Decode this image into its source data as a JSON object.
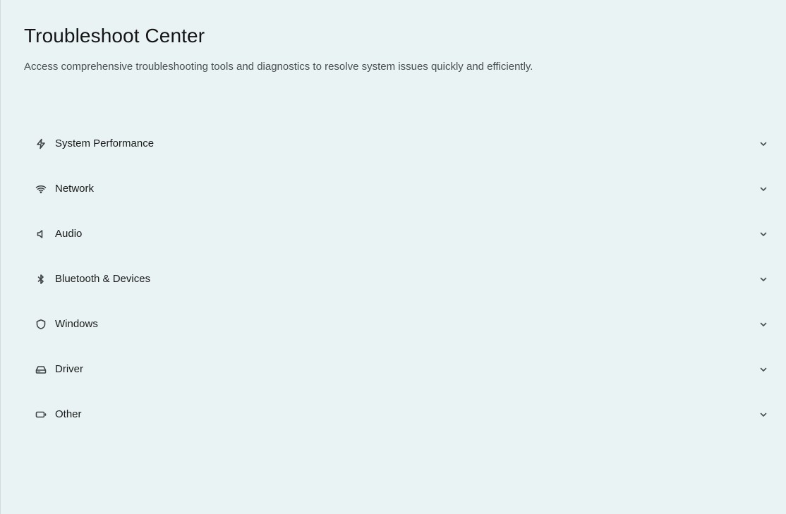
{
  "header": {
    "title": "Troubleshoot Center",
    "subtitle": "Access comprehensive troubleshooting tools and diagnostics to resolve system issues quickly and efficiently."
  },
  "categories": [
    {
      "label": "System Performance",
      "icon": "lightning-icon"
    },
    {
      "label": "Network",
      "icon": "wifi-icon"
    },
    {
      "label": "Audio",
      "icon": "speaker-icon"
    },
    {
      "label": "Bluetooth & Devices",
      "icon": "bluetooth-icon"
    },
    {
      "label": "Windows",
      "icon": "shield-icon"
    },
    {
      "label": "Driver",
      "icon": "hard-drive-icon"
    },
    {
      "label": "Other",
      "icon": "battery-icon"
    }
  ],
  "colors": {
    "background": "#e9f3f4",
    "text": "#1b1b1b",
    "muted_text": "#4a4f52",
    "icon": "#3f4447"
  }
}
